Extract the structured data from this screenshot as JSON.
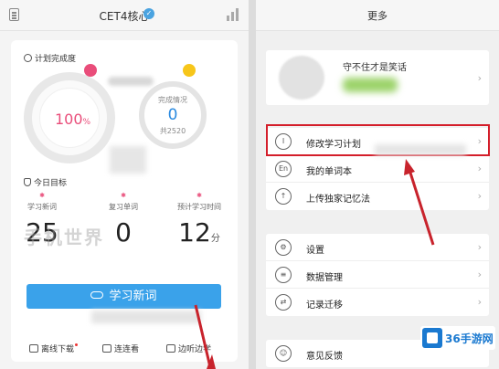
{
  "left": {
    "title": "CET4核心",
    "verified_badge": "✓",
    "plan_label": "计划完成度",
    "plan_percent": "100",
    "plan_percent_unit": "%",
    "done_label": "完成情况",
    "done_value": "0",
    "done_total": "共2520",
    "today_label": "今日目标",
    "stats": [
      {
        "caption": "学习新词",
        "value": "25",
        "unit": ""
      },
      {
        "caption": "复习单词",
        "value": "0",
        "unit": ""
      },
      {
        "caption": "预计学习时间",
        "value": "12",
        "unit": "分"
      }
    ],
    "watermark": "手机世界",
    "learn_button": "学习新词",
    "bottom_links": [
      "离线下载",
      "连连看",
      "边听边学"
    ]
  },
  "right": {
    "title": "更多",
    "motto": "守不住才是笑话",
    "group1": [
      "修改学习计划",
      "我的单词本",
      "上传独家记忆法"
    ],
    "group2": [
      "设置",
      "数据管理",
      "记录迁移"
    ],
    "group3": [
      "意见反馈"
    ],
    "icons_group1": [
      "Ⅰ",
      "En",
      "↑"
    ],
    "icons_group2": [
      "⚙",
      "≡",
      "⇄"
    ],
    "icons_group3": [
      "☺"
    ]
  },
  "logo": {
    "text": "36手游网"
  },
  "colors": {
    "accent": "#3aa2ea",
    "pink": "#e94d7a",
    "highlight": "#d41e2a"
  }
}
